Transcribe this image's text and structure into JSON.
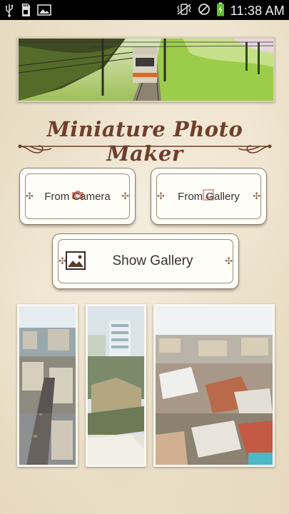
{
  "status_bar": {
    "time": "11:38 AM",
    "icons": [
      "usb-icon",
      "sd-card-icon",
      "image-icon",
      "vibrate-icon",
      "no-signal-icon",
      "battery-charging-icon"
    ]
  },
  "app": {
    "title": "Miniature Photo Maker"
  },
  "buttons": {
    "from_camera": "From Camera",
    "from_gallery": "From Gallery",
    "show_gallery": "Show Gallery"
  },
  "gallery": {
    "photos": [
      "tilt-shift-city-street",
      "tilt-shift-buildings",
      "tilt-shift-rooftops"
    ]
  },
  "colors": {
    "title": "#6d3f2c",
    "background": "#efe6d3",
    "status_bar": "#000000",
    "ornament": "#8a6a55"
  }
}
